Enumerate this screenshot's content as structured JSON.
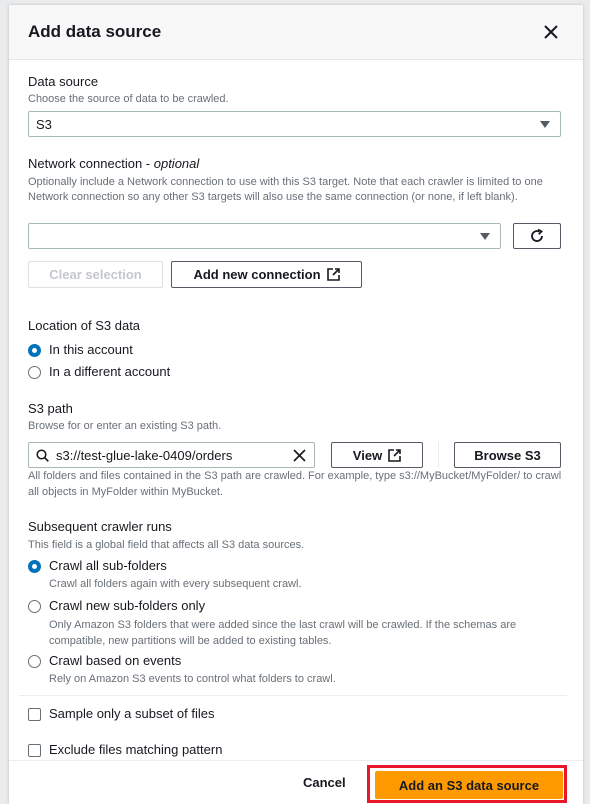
{
  "modal": {
    "title": "Add data source",
    "close_icon": "close-icon",
    "data_source": {
      "label": "Data source",
      "description": "Choose the source of data to be crawled.",
      "value": "S3"
    },
    "network_connection": {
      "label": "Network connection - ",
      "label_optional": "optional",
      "description": "Optionally include a Network connection to use with this S3 target. Note that each crawler is limited to one Network connection so any other S3 targets will also use the same connection (or none, if left blank).",
      "value": "",
      "clear_label": "Clear selection",
      "add_label": "Add new connection"
    },
    "location": {
      "label": "Location of S3 data",
      "options": [
        {
          "label": "In this account",
          "selected": true
        },
        {
          "label": "In a different account",
          "selected": false
        }
      ]
    },
    "s3_path": {
      "label": "S3 path",
      "description": "Browse for or enter an existing S3 path.",
      "value": "s3://test-glue-lake-0409/orders",
      "view_label": "View",
      "browse_label": "Browse S3",
      "help": "All folders and files contained in the S3 path are crawled. For example, type s3://MyBucket/MyFolder/ to crawl all objects in MyFolder within MyBucket."
    },
    "subsequent": {
      "label": "Subsequent crawler runs",
      "description": "This field is a global field that affects all S3 data sources.",
      "options": [
        {
          "label": "Crawl all sub-folders",
          "description": "Crawl all folders again with every subsequent crawl.",
          "selected": true
        },
        {
          "label": "Crawl new sub-folders only",
          "description": "Only Amazon S3 folders that were added since the last crawl will be crawled. If the schemas are compatible, new partitions will be added to existing tables.",
          "selected": false
        },
        {
          "label": "Crawl based on events",
          "description": "Rely on Amazon S3 events to control what folders to crawl.",
          "selected": false
        }
      ]
    },
    "checkboxes": [
      {
        "label": "Sample only a subset of files",
        "checked": false
      },
      {
        "label": "Exclude files matching pattern",
        "checked": false
      }
    ],
    "footer": {
      "cancel_label": "Cancel",
      "submit_label": "Add an S3 data source"
    }
  },
  "colors": {
    "primary": "#ff9900",
    "radio_selected": "#0073bb",
    "highlight": "#e8182a"
  }
}
